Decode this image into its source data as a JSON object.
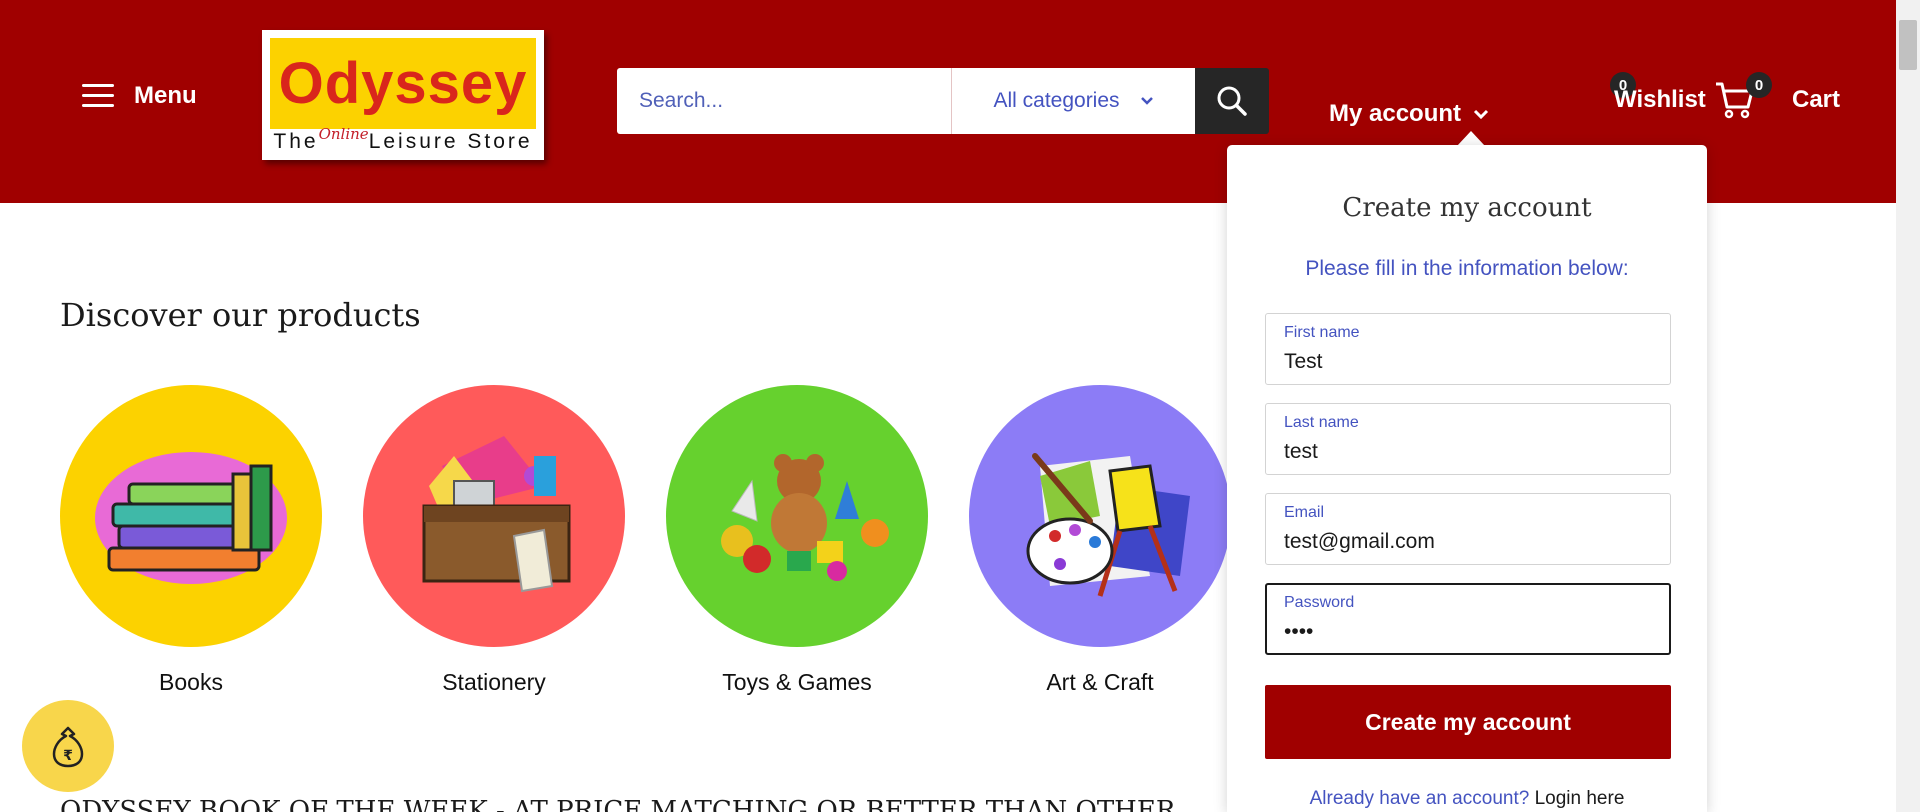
{
  "header": {
    "menu_label": "Menu",
    "logo": {
      "brand": "Odyssey",
      "tagline_left": "The",
      "tagline_script": "Online",
      "tagline_right": "Leisure Store"
    },
    "search": {
      "placeholder": "Search...",
      "category": "All categories"
    },
    "my_account_label": "My account",
    "wishlist_label": "Wishlist",
    "wishlist_count": "0",
    "cart_label": "Cart",
    "cart_count": "0",
    "brand_color": "#a00000"
  },
  "main": {
    "section_title": "Discover our products",
    "categories": [
      {
        "label": "Books",
        "color": "#fcd200",
        "icon": "books-icon"
      },
      {
        "label": "Stationery",
        "color": "#ff5a5a",
        "icon": "stationery-box-icon"
      },
      {
        "label": "Toys & Games",
        "color": "#66d12e",
        "icon": "toys-icon"
      },
      {
        "label": "Art & Craft",
        "color": "#8c7cf6",
        "icon": "art-palette-icon"
      }
    ],
    "book_of_week": "ODYSSEY BOOK OF THE WEEK - AT PRICE MATCHING OR BETTER THAN OTHER"
  },
  "account_dropdown": {
    "title": "Create my account",
    "subtitle": "Please fill in the information below:",
    "fields": [
      {
        "label": "First name",
        "value": "Test"
      },
      {
        "label": "Last name",
        "value": "test"
      },
      {
        "label": "Email",
        "value": "test@gmail.com"
      },
      {
        "label": "Password",
        "value": "••••"
      }
    ],
    "submit_label": "Create my account",
    "login_question": "Already have an account?",
    "login_link": "Login here"
  },
  "floating_button": {
    "icon": "rupee-money-bag-icon"
  }
}
